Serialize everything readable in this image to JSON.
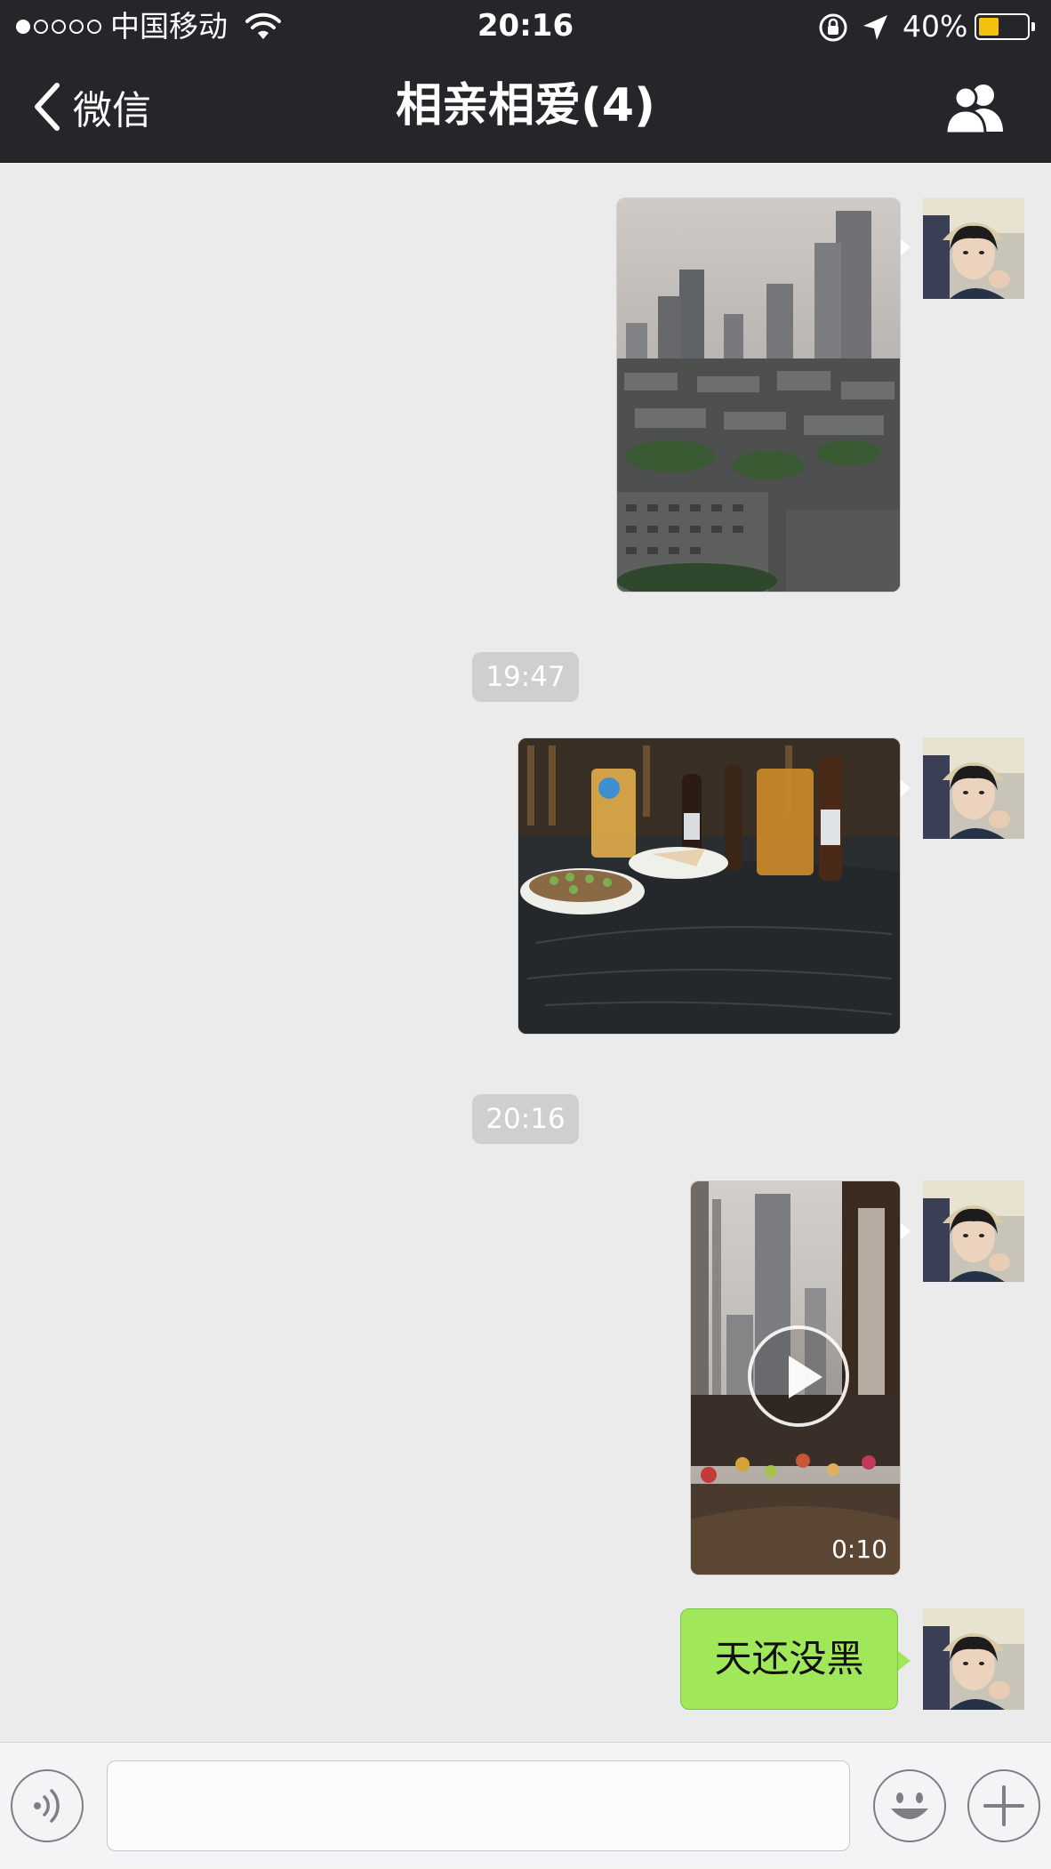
{
  "status_bar": {
    "carrier": "中国移动",
    "time": "20:16",
    "battery_text": "40%",
    "battery_level": 0.4,
    "signal_dots": [
      true,
      false,
      false,
      false,
      false
    ],
    "icons": [
      "wifi-icon",
      "rotation-lock-icon",
      "location-arrow-icon",
      "battery-icon"
    ]
  },
  "nav": {
    "back_label": "微信",
    "title": "相亲相爱(4)",
    "icons": [
      "chevron-left-icon",
      "group-members-icon"
    ]
  },
  "chat": {
    "timestamps": [
      "19:47",
      "20:16"
    ],
    "messages": [
      {
        "type": "image",
        "subject": "city-skyline-photo"
      },
      {
        "type": "image",
        "subject": "table-drinks-photo"
      },
      {
        "type": "video",
        "duration": "0:10"
      },
      {
        "type": "text",
        "text": "天还没黑"
      }
    ]
  },
  "input_bar": {
    "message_value": "",
    "icons": [
      "voice-icon",
      "emoji-icon",
      "plus-icon"
    ]
  },
  "colors": {
    "bar_dark": "#26262a",
    "chat_bg": "#ebebeb",
    "bubble_green": "#a0e75a",
    "battery_yellow": "#f4c20d",
    "time_chip": "#cfcfcf"
  }
}
